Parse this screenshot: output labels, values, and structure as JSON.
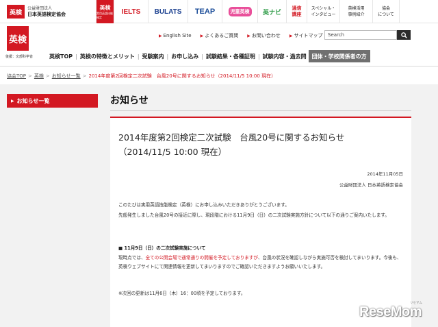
{
  "header": {
    "org_badge": "英検",
    "org_line1": "公益財団法人",
    "org_line2": "日本英語検定協会",
    "brands": {
      "eiken": "英検",
      "eiken_sub": "実用英語技能検定",
      "ielts": "IELTS",
      "bulats": "BULATS",
      "teap": "TEAP",
      "jidou": "児童英検",
      "navi": "英ナビ",
      "tsushin_l1": "通信",
      "tsushin_l2": "講座",
      "special_l1": "スペシャル・",
      "special_l2": "インタビュー",
      "katsuyo_l1": "英検活用",
      "katsuyo_l2": "事例紹介",
      "about_l1": "協会",
      "about_l2": "について"
    },
    "logo": "英検",
    "logo_caption": "後援：文部科学省",
    "utility_links": [
      "English Site",
      "よくあるご質問",
      "お問い合わせ",
      "サイトマップ"
    ],
    "search_placeholder": "Search"
  },
  "nav": {
    "items": [
      "英検TOP",
      "英検の特徴とメリット",
      "受験案内",
      "お申し込み",
      "試験結果・各種証明",
      "試験内容・過去問"
    ],
    "last": "団体・学校関係者の方"
  },
  "breadcrumb": {
    "items": [
      "協会TOP",
      "英検",
      "お知らせ一覧"
    ],
    "current": "2014年度第2回検定二次試験　台風20号に関するお知らせ（2014/11/5 10:00 現在）"
  },
  "sidebar": {
    "button": "お知らせ一覧"
  },
  "main": {
    "heading": "お知らせ",
    "article": {
      "title_line1": "2014年度第2回検定二次試験　台風20号に関するお知らせ",
      "title_line2": "（2014/11/5 10:00 現在）",
      "date": "2014年11月05日",
      "author": "公益財団法人 日本英語検定協会",
      "para1": "このたびは実用英語技能検定（英検）にお申し込みいただきありがとうございます。",
      "para2": "先般発生しました台風20号の接近に際し、現段階における11月9日（日）の二次試験実施方針について以下の通りご案内いたします。",
      "section_title": "■ 11月9日（日）の二次試験実施について",
      "para3_prefix": "現時点では、",
      "para3_red": "全ての公開会場で通常通りの開催を予定しておりますが",
      "para3_suffix": "、台風の状況を確認しながら実施可否を検討してまいります。今後も、英検ウェブサイトにて関連情報を更新してまいりますのでご確認いただきますようお願いいたします。",
      "note": "※次回の更新は11月6日（木）16：00頃を予定しております。"
    }
  },
  "watermark": {
    "text": "ReseMom",
    "kana": "リセマム"
  },
  "colors": {
    "brand_red": "#d31822",
    "nav_gray": "#707070",
    "background_gray": "#f2f2f2"
  }
}
